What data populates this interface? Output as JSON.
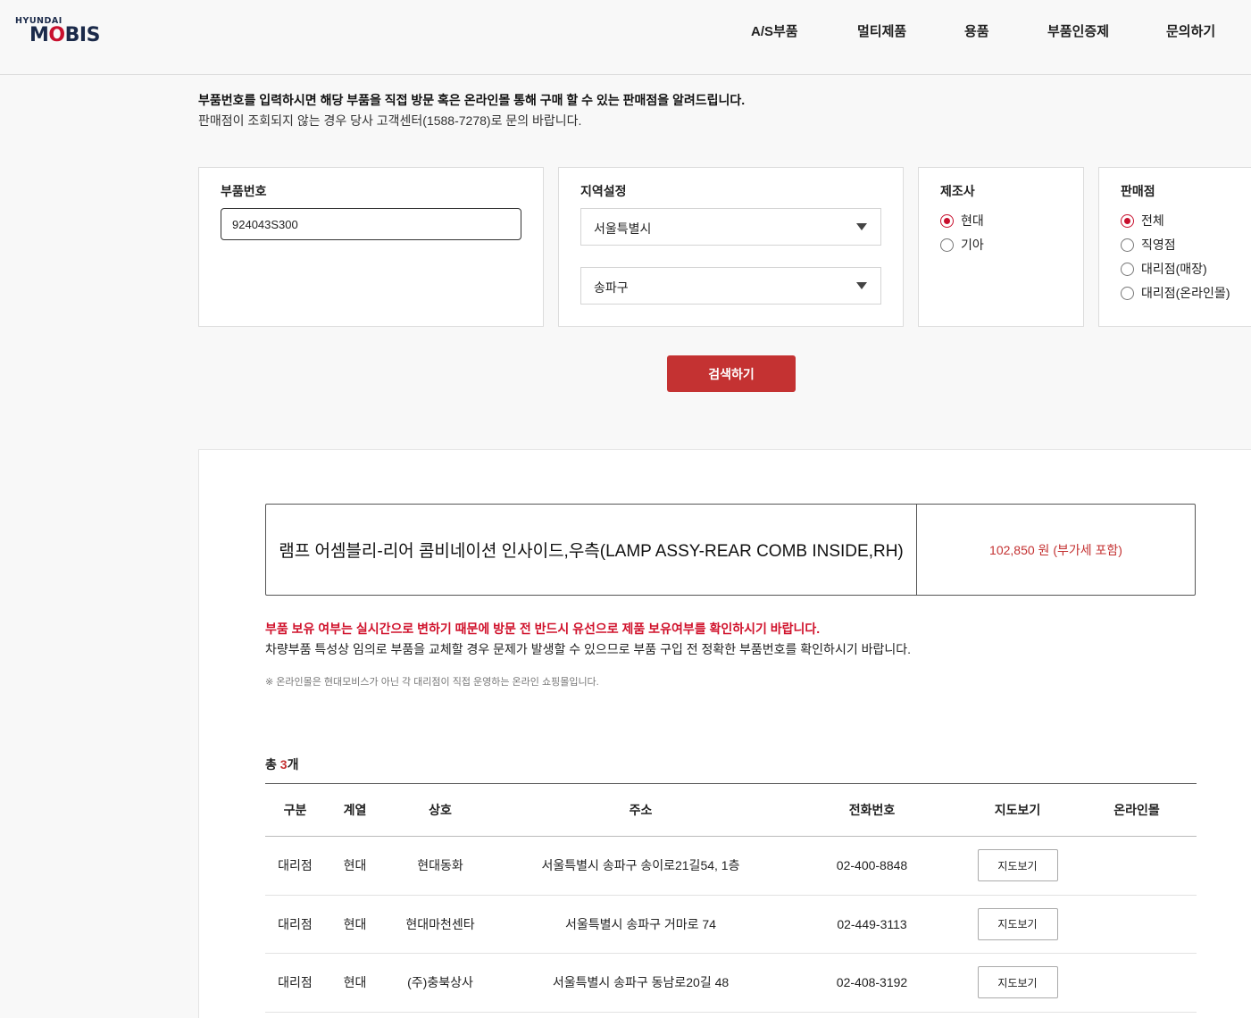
{
  "header": {
    "logo_top": "HYUNDAI",
    "logo_main_prefix": "M",
    "logo_main_accent": "O",
    "logo_main_suffix": "BIS",
    "nav": [
      "A/S부품",
      "멀티제품",
      "용품",
      "부품인증제",
      "문의하기"
    ]
  },
  "intro": {
    "line1": "부품번호를 입력하시면 해당 부품을 직접 방문 혹은 온라인몰 통해 구매 할 수 있는 판매점을 알려드립니다.",
    "line2": "판매점이 조회되지 않는 경우 당사 고객센터(1588-7278)로 문의 바랍니다."
  },
  "filters": {
    "part_number": {
      "label": "부품번호",
      "value": "924043S300"
    },
    "region": {
      "label": "지역설정",
      "city": "서울특별시",
      "district": "송파구"
    },
    "manufacturer": {
      "label": "제조사",
      "options": [
        {
          "label": "현대",
          "selected": true
        },
        {
          "label": "기아",
          "selected": false
        }
      ]
    },
    "store_type": {
      "label": "판매점",
      "options": [
        {
          "label": "전체",
          "selected": true
        },
        {
          "label": "직영점",
          "selected": false
        },
        {
          "label": "대리점(매장)",
          "selected": false
        },
        {
          "label": "대리점(온라인몰)",
          "selected": false
        }
      ]
    },
    "search_button": "검색하기"
  },
  "product": {
    "name": "램프 어셈블리-리어 콤비네이션 인사이드,우측(LAMP ASSY-REAR COMB INSIDE,RH)",
    "price": "102,850 원 (부가세 포함)"
  },
  "notices": {
    "warning": "부품 보유 여부는 실시간으로 변하기 때문에 방문 전 반드시 유선으로 제품 보유여부를 확인하시기 바랍니다.",
    "info": "차량부품 특성상 임의로 부품을 교체할 경우 문제가 발생할 수 있으므로 부품 구입 전 정확한 부품번호를 확인하시기 바랍니다.",
    "footnote": "※ 온라인몰은 현대모비스가 아닌 각 대리점이 직접 운영하는 온라인 쇼핑몰입니다."
  },
  "results": {
    "total_prefix": "총 ",
    "total_count": "3",
    "total_suffix": "개",
    "columns": [
      "구분",
      "계열",
      "상호",
      "주소",
      "전화번호",
      "지도보기",
      "온라인몰"
    ],
    "rows": [
      {
        "type": "대리점",
        "brand": "현대",
        "name": "현대동화",
        "address": "서울특별시 송파구 송이로21길54, 1층",
        "phone": "02-400-8848",
        "map_label": "지도보기",
        "online": ""
      },
      {
        "type": "대리점",
        "brand": "현대",
        "name": "현대마천센타",
        "address": "서울특별시 송파구 거마로 74",
        "phone": "02-449-3113",
        "map_label": "지도보기",
        "online": ""
      },
      {
        "type": "대리점",
        "brand": "현대",
        "name": "(주)충북상사",
        "address": "서울특별시 송파구 동남로20길 48",
        "phone": "02-408-3192",
        "map_label": "지도보기",
        "online": ""
      }
    ]
  },
  "colors": {
    "brand_navy": "#1b2a4a",
    "brand_red": "#c8102e",
    "button_red": "#c43232",
    "warning_red": "#d0112b"
  }
}
